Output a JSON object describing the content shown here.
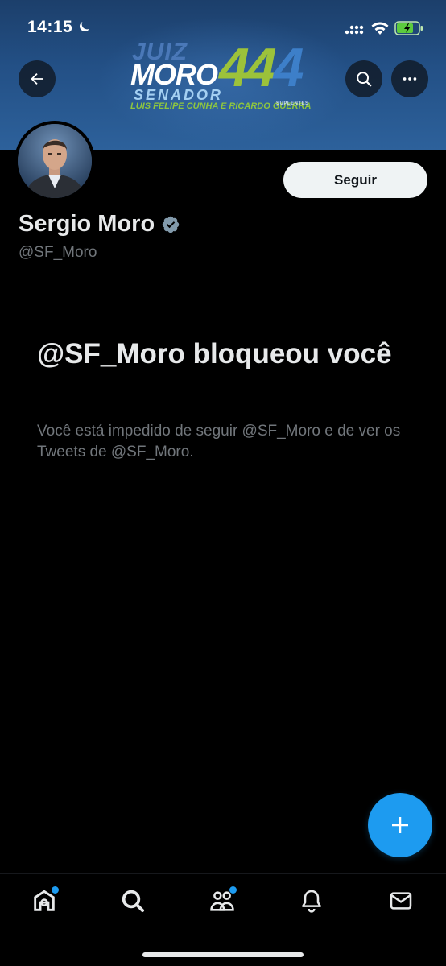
{
  "status_bar": {
    "time": "14:15",
    "icons": [
      "moon-icon",
      "signal-icon",
      "wifi-icon",
      "battery-icon"
    ]
  },
  "header": {
    "back_icon": "arrow-left-icon",
    "search_icon": "search-icon",
    "more_icon": "more-horizontal-icon",
    "banner": {
      "juiz": "JUIZ",
      "moro": "MORO",
      "number": "444",
      "senador": "SENADOR",
      "suplentes_names": "LUIS FELIPE CUNHA E RICARDO GUERRA",
      "suplentes_label": "SUPLENTES"
    }
  },
  "profile": {
    "name": "Sergio Moro",
    "handle": "@SF_Moro",
    "verified": true,
    "follow_label": "Seguir"
  },
  "blocked": {
    "title": "@SF_Moro bloqueou você",
    "description": "Você está impedido de seguir @SF_Moro e de ver os Tweets de @SF_Moro."
  },
  "fab": {
    "icon": "plus-icon"
  },
  "bottom_nav": {
    "items": [
      {
        "icon": "home-icon",
        "has_dot": true
      },
      {
        "icon": "search-icon",
        "has_dot": false
      },
      {
        "icon": "communities-icon",
        "has_dot": true
      },
      {
        "icon": "bell-icon",
        "has_dot": false
      },
      {
        "icon": "mail-icon",
        "has_dot": false
      }
    ]
  },
  "colors": {
    "accent": "#1d9bf0",
    "background": "#000000",
    "text_primary": "#e7e9ea",
    "text_secondary": "#71767b",
    "follow_button_bg": "#eff3f4"
  }
}
